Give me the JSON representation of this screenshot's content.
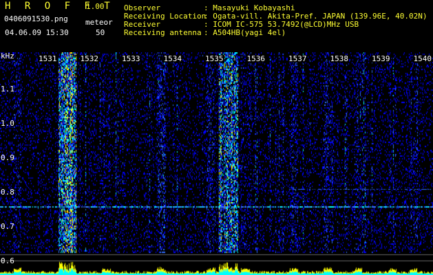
{
  "header": {
    "app_name": "H R O F F T",
    "version": "1.00",
    "filename": "0406091530.png",
    "mode": "meteor",
    "datetime": "04.06.09 15:30",
    "count": "50",
    "observer_label": "Observer",
    "observer_value": ": Masayuki Kobayashi",
    "location_label": "Receiving Location",
    "location_value": ": Ogata-vill. Akita-Pref. JAPAN (139.96E, 40.02N)",
    "receiver_label": "Receiver",
    "receiver_value": ": ICOM IC-575 53.7492(@LCD)MHz USB",
    "antenna_label": "Receiving antenna",
    "antenna_value": ": A504HB(yagi 4el)"
  },
  "axis": {
    "y_unit": "kHz",
    "y_labels": [
      {
        "text": "1.1",
        "value": 1.1
      },
      {
        "text": "1.0",
        "value": 1.0
      },
      {
        "text": "0.9",
        "value": 0.9
      },
      {
        "text": "0.8",
        "value": 0.8
      },
      {
        "text": "0.7",
        "value": 0.7
      },
      {
        "text": "0.6",
        "value": 0.6
      }
    ],
    "time_labels": [
      "1531",
      "1532",
      "1533",
      "1534",
      "1535",
      "1536",
      "1537",
      "1538",
      "1539",
      "1540"
    ]
  },
  "colors": {
    "header_yellow": "#ffff33",
    "waterfall_background": "#000000",
    "signal_low": "#0000ff",
    "signal_mid": "#00ffff",
    "signal_high": "#ffff00",
    "signal_peak": "#ff0000"
  }
}
